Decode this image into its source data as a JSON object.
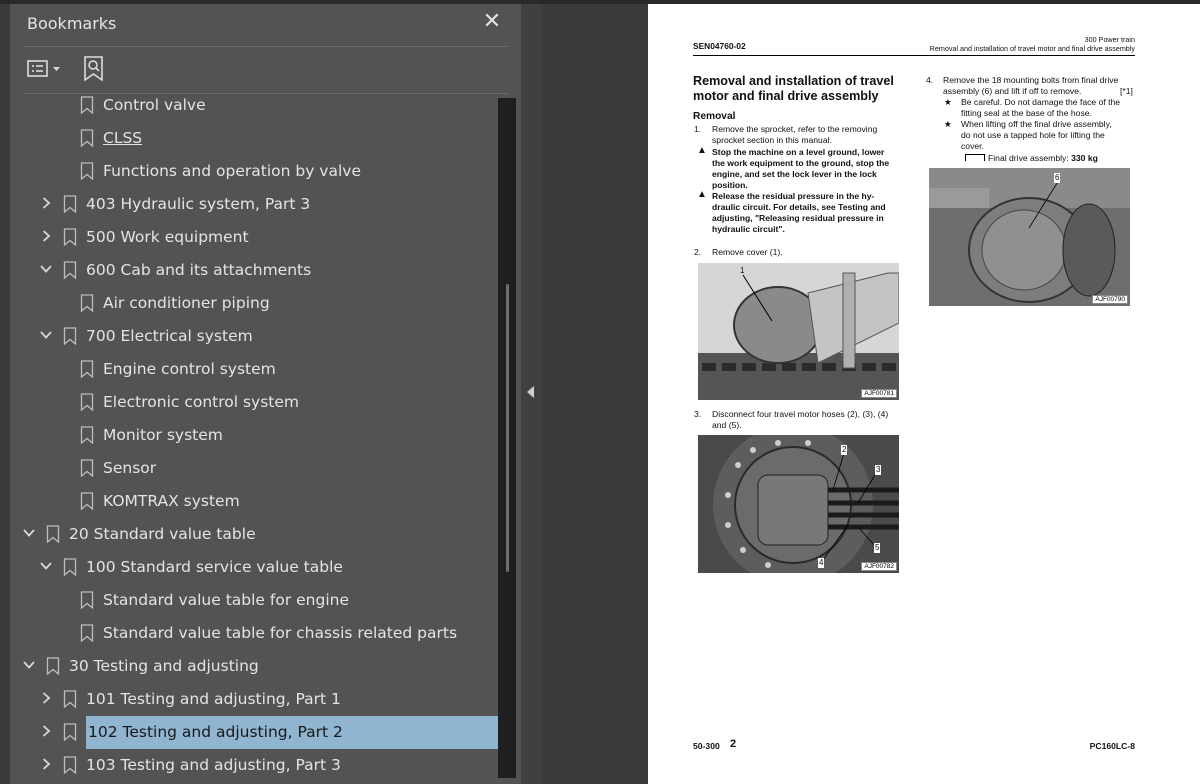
{
  "panel": {
    "title": "Bookmarks",
    "close_icon": "close-icon",
    "options_icon": "list-options-icon",
    "find_icon": "find-bookmark-icon"
  },
  "bookmarks": [
    {
      "label": "Control valve",
      "chevron": "none",
      "level": 2
    },
    {
      "label": "CLSS",
      "chevron": "none",
      "level": 2,
      "underline": true
    },
    {
      "label": "Functions and operation by valve",
      "chevron": "none",
      "level": 2
    },
    {
      "label": "403 Hydraulic system, Part 3",
      "chevron": "right",
      "level": 1
    },
    {
      "label": "500 Work equipment",
      "chevron": "right",
      "level": 1
    },
    {
      "label": "600 Cab and its attachments",
      "chevron": "down",
      "level": 1
    },
    {
      "label": "Air conditioner piping",
      "chevron": "none",
      "level": 2
    },
    {
      "label": "700 Electrical system",
      "chevron": "down",
      "level": 1
    },
    {
      "label": "Engine control system",
      "chevron": "none",
      "level": 2
    },
    {
      "label": "Electronic control system",
      "chevron": "none",
      "level": 2
    },
    {
      "label": "Monitor system",
      "chevron": "none",
      "level": 2
    },
    {
      "label": "Sensor",
      "chevron": "none",
      "level": 2
    },
    {
      "label": "KOMTRAX system",
      "chevron": "none",
      "level": 2
    },
    {
      "label": "20 Standard value table",
      "chevron": "down",
      "level": 0
    },
    {
      "label": "100 Standard service value table",
      "chevron": "down",
      "level": 1
    },
    {
      "label": "Standard value table for engine",
      "chevron": "none",
      "level": 2
    },
    {
      "label": "Standard value table for chassis related parts",
      "chevron": "none",
      "level": 2
    },
    {
      "label": "30 Testing and adjusting",
      "chevron": "down",
      "level": 0
    },
    {
      "label": "101 Testing and adjusting, Part 1",
      "chevron": "right",
      "level": 1
    },
    {
      "label": "102 Testing and adjusting, Part 2",
      "chevron": "right",
      "level": 1,
      "selected": true
    },
    {
      "label": "103 Testing and adjusting, Part 3",
      "chevron": "right",
      "level": 1
    }
  ],
  "doc": {
    "doc_id": "SEN04760-02",
    "header_section": "300 Power train",
    "header_sub": "Removal and installation of travel motor and final drive assembly",
    "title_line1": "Removal and installation of travel",
    "title_line2": "motor and final drive assembly",
    "removal": "Removal",
    "s1_num": "1.",
    "s1_l1": "Remove the sprocket, refer to the removing",
    "s1_l2": "sprocket section in this manual.",
    "w1_l1": "Stop the machine on a level ground, lower",
    "w1_l2": "the work equipment to the ground, stop the",
    "w1_l3": "engine, and set the lock lever in the lock",
    "w1_l4": "position.",
    "w2_l1": "Release the residual pressure in the hy-",
    "w2_l2": "draulic circuit.  For details, see Testing and",
    "w2_l3": "adjusting, \"Releasing residual pressure in",
    "w2_l4": "hydraulic circuit\".",
    "s2_num": "2.",
    "s2_text": "Remove cover (1).",
    "img1_label": "1",
    "img1_code": "AJF00781",
    "s3_num": "3.",
    "s3_l1": "Disconnect four travel motor hoses (2), (3), (4)",
    "s3_l2": "and (5).",
    "img2_labels": [
      "2",
      "3",
      "4",
      "5"
    ],
    "img2_code": "AJF00782",
    "s4_num": "4.",
    "s4_l1": "Remove the 18 mounting bolts from final drive",
    "s4_l2": "assembly (6) and lift if off to remove.",
    "s4_ref": "[*1]",
    "n1_l1": "Be careful. Do not damage the face of the",
    "n1_l2": "fitting seal at the base of the hose.",
    "n2_l1": "When lifting off the final drive assembly,",
    "n2_l2": "do not use a tapped hole for lifting the",
    "n2_l3": "cover.",
    "weight_label": "Final drive assembly:",
    "weight_value": "330 kg",
    "img3_label": "6",
    "img3_code": "AJF00790",
    "footer_page": "50-300",
    "footer_rev": "2",
    "footer_model": "PC160LC-8"
  }
}
